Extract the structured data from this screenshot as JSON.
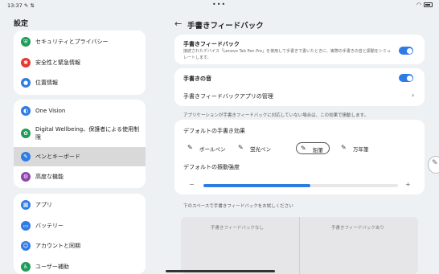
{
  "status": {
    "time": "13:37",
    "icons_left": "✎ ⇅",
    "dots": "•••",
    "wifi_icon": "wifi-icon",
    "battery_icon": "battery-icon"
  },
  "left": {
    "title": "設定",
    "group1": [
      {
        "label": "セキュリティとプライバシー",
        "icon": "shield-icon",
        "color": "#1f9b5a",
        "glyph": "⛨"
      },
      {
        "label": "安全性と緊急情報",
        "icon": "asterisk-icon",
        "color": "#e53935",
        "glyph": "✱"
      },
      {
        "label": "位置情報",
        "icon": "location-pin-icon",
        "color": "#2f7be4",
        "glyph": "●"
      }
    ],
    "group2": [
      {
        "label": "One Vision",
        "icon": "one-vision-icon",
        "color": "#2f7be4",
        "glyph": "◐"
      },
      {
        "label": "Digital Wellbeing、保護者による使用制限",
        "icon": "wellbeing-icon",
        "color": "#1f9b5a",
        "glyph": "✿"
      },
      {
        "label": "ペンとキーボード",
        "icon": "pen-keyboard-icon",
        "color": "#2f7be4",
        "glyph": "✎"
      },
      {
        "label": "高度な機能",
        "icon": "advanced-features-icon",
        "color": "#8e44ad",
        "glyph": "⚙"
      }
    ],
    "group3": [
      {
        "label": "アプリ",
        "icon": "apps-icon",
        "color": "#2f7be4",
        "glyph": "▦"
      },
      {
        "label": "バッテリー",
        "icon": "battery-settings-icon",
        "color": "#2f7be4",
        "glyph": "▭"
      },
      {
        "label": "アカウントと同期",
        "icon": "account-icon",
        "color": "#2f7be4",
        "glyph": "☺"
      },
      {
        "label": "ユーザー補助",
        "icon": "accessibility-icon",
        "color": "#1f9b5a",
        "glyph": "♿"
      }
    ]
  },
  "right": {
    "title": "手書きフィードバック",
    "feedback_title": "手書きフィードバック",
    "feedback_sub": "接続されたデバイス「Lenovo Tab Pen Pro」を使用して手書きで書いたときに、実際の手書きの音と振動をシミュレートします。",
    "feedback_on": true,
    "sound_title": "手書きの音",
    "sound_on": true,
    "app_manage_title": "手書きフィードバックアプリの管理",
    "note": "アプリケーションが手書きフィードバックに対応していない場合は、この効果で振動します。",
    "effect_title": "デフォルトの手書き効果",
    "effects": [
      {
        "label": "ボールペン",
        "icon": "ballpoint-pen-icon",
        "selected": false
      },
      {
        "label": "蛍光ペン",
        "icon": "highlighter-icon",
        "selected": false
      },
      {
        "label": "鉛筆",
        "icon": "pencil-icon",
        "selected": true
      },
      {
        "label": "万年筆",
        "icon": "fountain-pen-icon",
        "selected": false
      }
    ],
    "vibration_title": "デフォルトの振動強度",
    "vibration_minus": "−",
    "vibration_plus": "+",
    "vibration_level": 0.55,
    "try_prompt": "下のスペースで手書きフィードバックをお試しください",
    "try_left": "手書きフィードバックなし",
    "try_right": "手書きフィードバックあり"
  }
}
